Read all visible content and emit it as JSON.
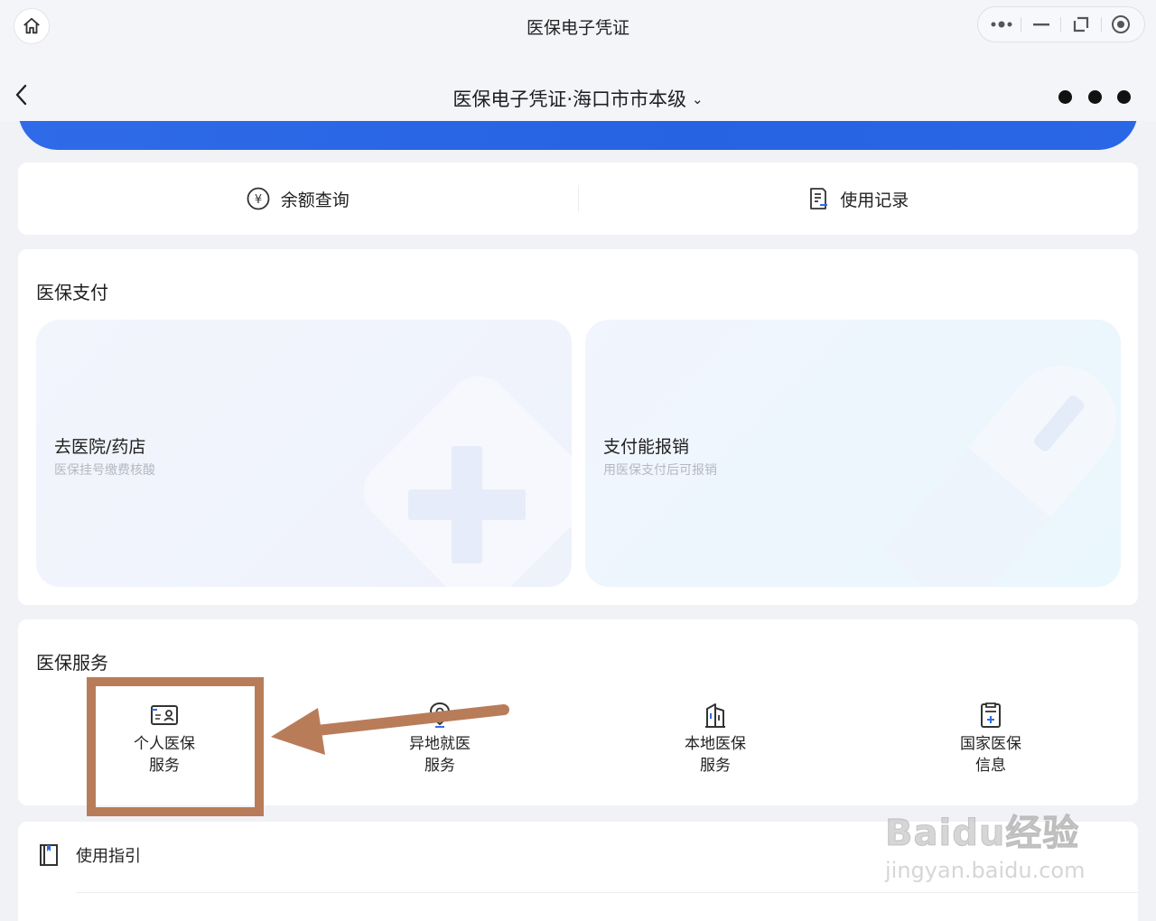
{
  "window": {
    "title": "医保电子凭证",
    "icons": [
      "home-icon",
      "more-dots-icon",
      "minimize-icon",
      "restore-icon",
      "record-icon"
    ]
  },
  "navbar": {
    "title": "医保电子凭证·海口市市本级",
    "chevron": "⌄"
  },
  "quick_actions": [
    {
      "label": "余额查询",
      "icon": "yen-circle-icon"
    },
    {
      "label": "使用记录",
      "icon": "record-list-icon"
    }
  ],
  "payment": {
    "title": "医保支付",
    "tiles": [
      {
        "name": "去医院/药店",
        "sub": "医保挂号缴费核酸",
        "icon": "medical-cross-icon"
      },
      {
        "name": "支付能报销",
        "sub": "用医保支付后可报销",
        "icon": "pill-icon"
      }
    ]
  },
  "services": {
    "title": "医保服务",
    "items": [
      {
        "line1": "个人医保",
        "line2": "服务",
        "icon": "id-card-icon"
      },
      {
        "line1": "异地就医",
        "line2": "服务",
        "icon": "location-pin-icon"
      },
      {
        "line1": "本地医保",
        "line2": "服务",
        "icon": "building-icon"
      },
      {
        "line1": "国家医保",
        "line2": "信息",
        "icon": "document-plus-icon"
      }
    ]
  },
  "guide": {
    "label": "使用指引",
    "icon": "book-icon"
  },
  "annotation": {
    "color": "#b97c59"
  },
  "watermark": {
    "main": "Baidu经验",
    "sub": "jingyan.baidu.com"
  },
  "colors": {
    "banner_blue": "#2563e3",
    "background": "#f1f2f6",
    "subtext": "#b4b8c2"
  }
}
